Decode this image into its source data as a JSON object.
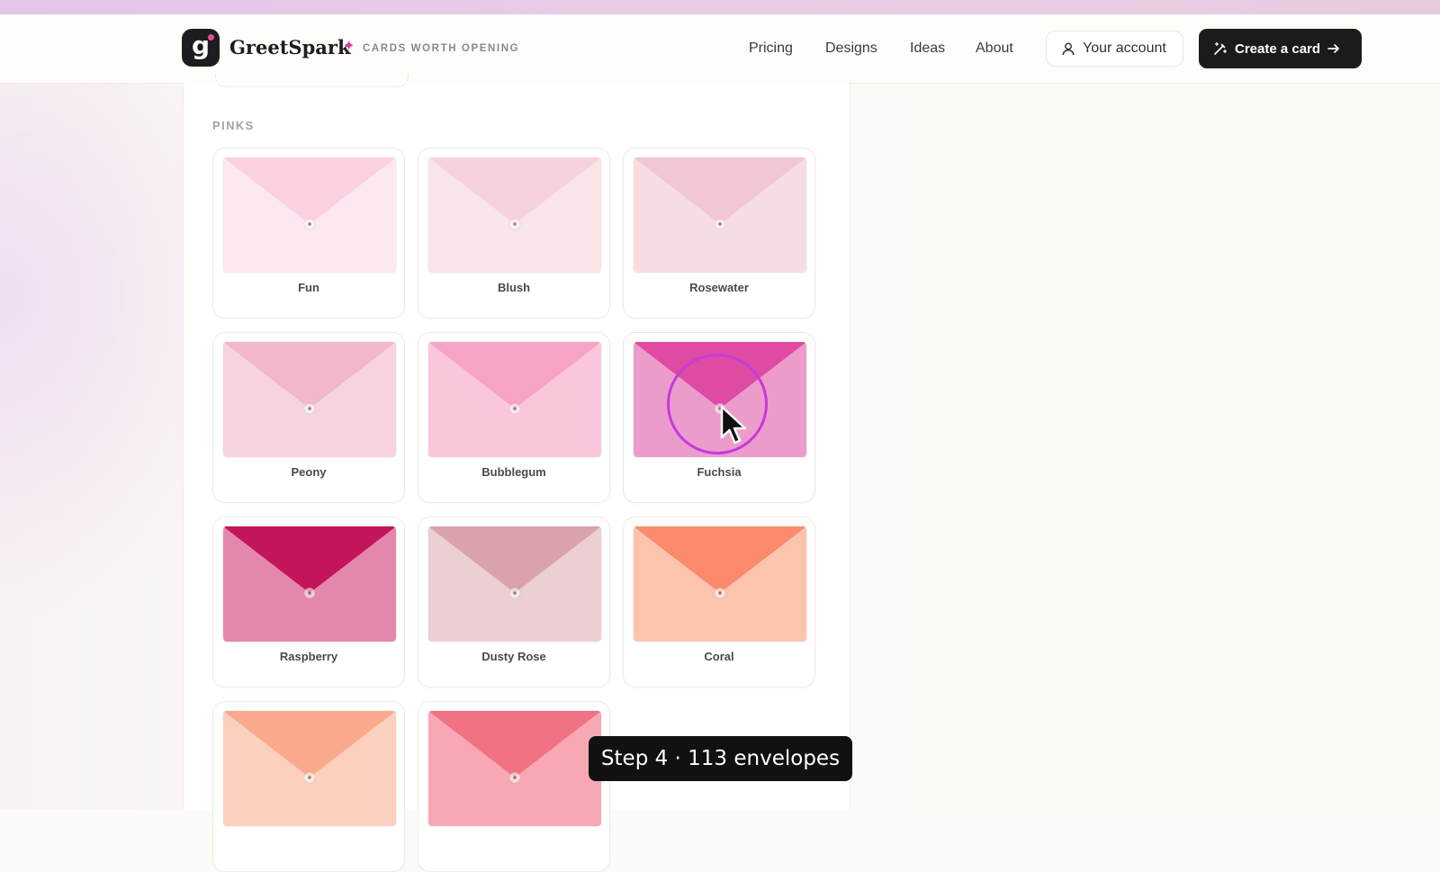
{
  "brand": {
    "logo_letter": "g",
    "name": "GreetSpark",
    "sparkle": "✦",
    "tagline": "CARDS WORTH OPENING"
  },
  "nav": {
    "links": [
      "Pricing",
      "Designs",
      "Ideas",
      "About"
    ],
    "account_label": "Your account",
    "create_label": "Create a card"
  },
  "section": {
    "label": "PINKS"
  },
  "swatches": [
    {
      "label": "Fun",
      "flap": "#fbd0e2",
      "body": "#fde7f0"
    },
    {
      "label": "Blush",
      "flap": "#f6d3da",
      "body": "#f9e4e8"
    },
    {
      "label": "Rosewater",
      "flap": "#f1c8d1",
      "body": "#f7dde2"
    },
    {
      "label": "Peony",
      "flap": "#f2b8c8",
      "body": "#f7d4dd"
    },
    {
      "label": "Bubblegum",
      "flap": "#f7a3c6",
      "body": "#fac6dc"
    },
    {
      "label": "Fuchsia",
      "flap": "#df4aa3",
      "body": "#ec9ccb",
      "selected": true
    },
    {
      "label": "Raspberry",
      "flap": "#c2155b",
      "body": "#e388ac"
    },
    {
      "label": "Dusty Rose",
      "flap": "#d9a3a9",
      "body": "#ebcfd2"
    },
    {
      "label": "Coral",
      "flap": "#fb8b6c",
      "body": "#fcc4ae"
    },
    {
      "label": "",
      "flap": "#f9aa8d",
      "body": "#fcd0bf"
    },
    {
      "label": "",
      "flap": "#f07283",
      "body": "#f7a8b4"
    }
  ],
  "caption": {
    "text": "Step 4 · 113 envelopes"
  }
}
